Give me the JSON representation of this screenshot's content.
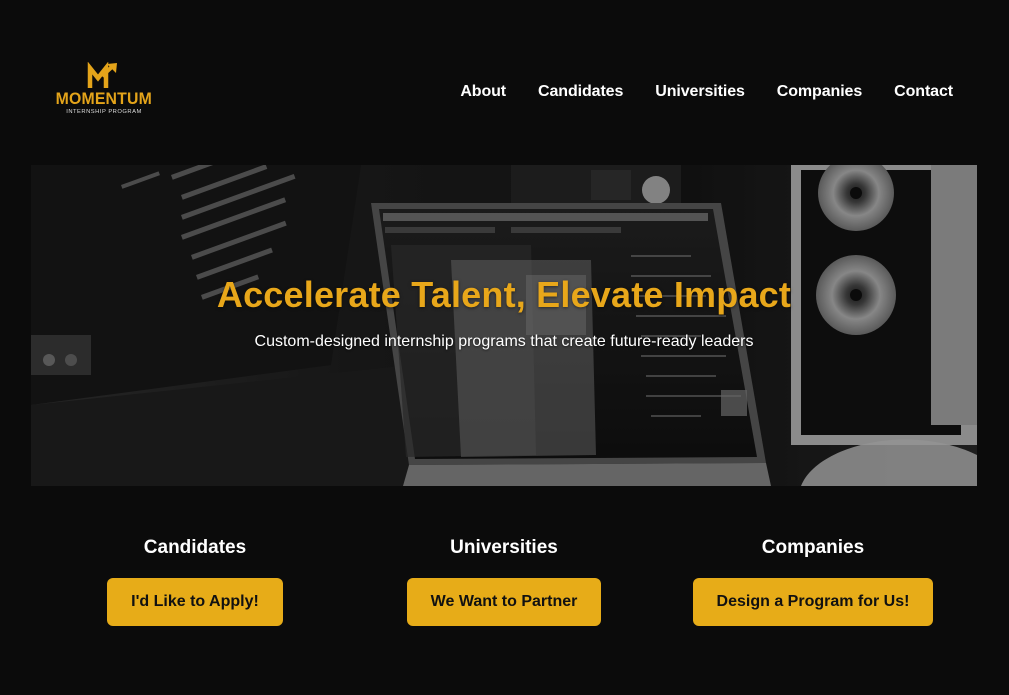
{
  "brand": {
    "name": "MOMENTUM",
    "tagline": "INTERNSHIP PROGRAM",
    "accent": "#e7ac18"
  },
  "nav": {
    "items": [
      {
        "label": "About"
      },
      {
        "label": "Candidates"
      },
      {
        "label": "Universities"
      },
      {
        "label": "Companies"
      },
      {
        "label": "Contact"
      }
    ]
  },
  "hero": {
    "title": "Accelerate Talent, Elevate Impact",
    "subtitle": "Custom-designed internship programs that create future-ready leaders",
    "image": "laptop-code-photo"
  },
  "sections": [
    {
      "heading": "Candidates",
      "button": "I'd Like to Apply!"
    },
    {
      "heading": "Universities",
      "button": "We Want to Partner"
    },
    {
      "heading": "Companies",
      "button": "Design a Program for Us!"
    }
  ],
  "colors": {
    "background": "#0b0b0b",
    "title": "#e8a71a",
    "button": "#e7ac18"
  }
}
